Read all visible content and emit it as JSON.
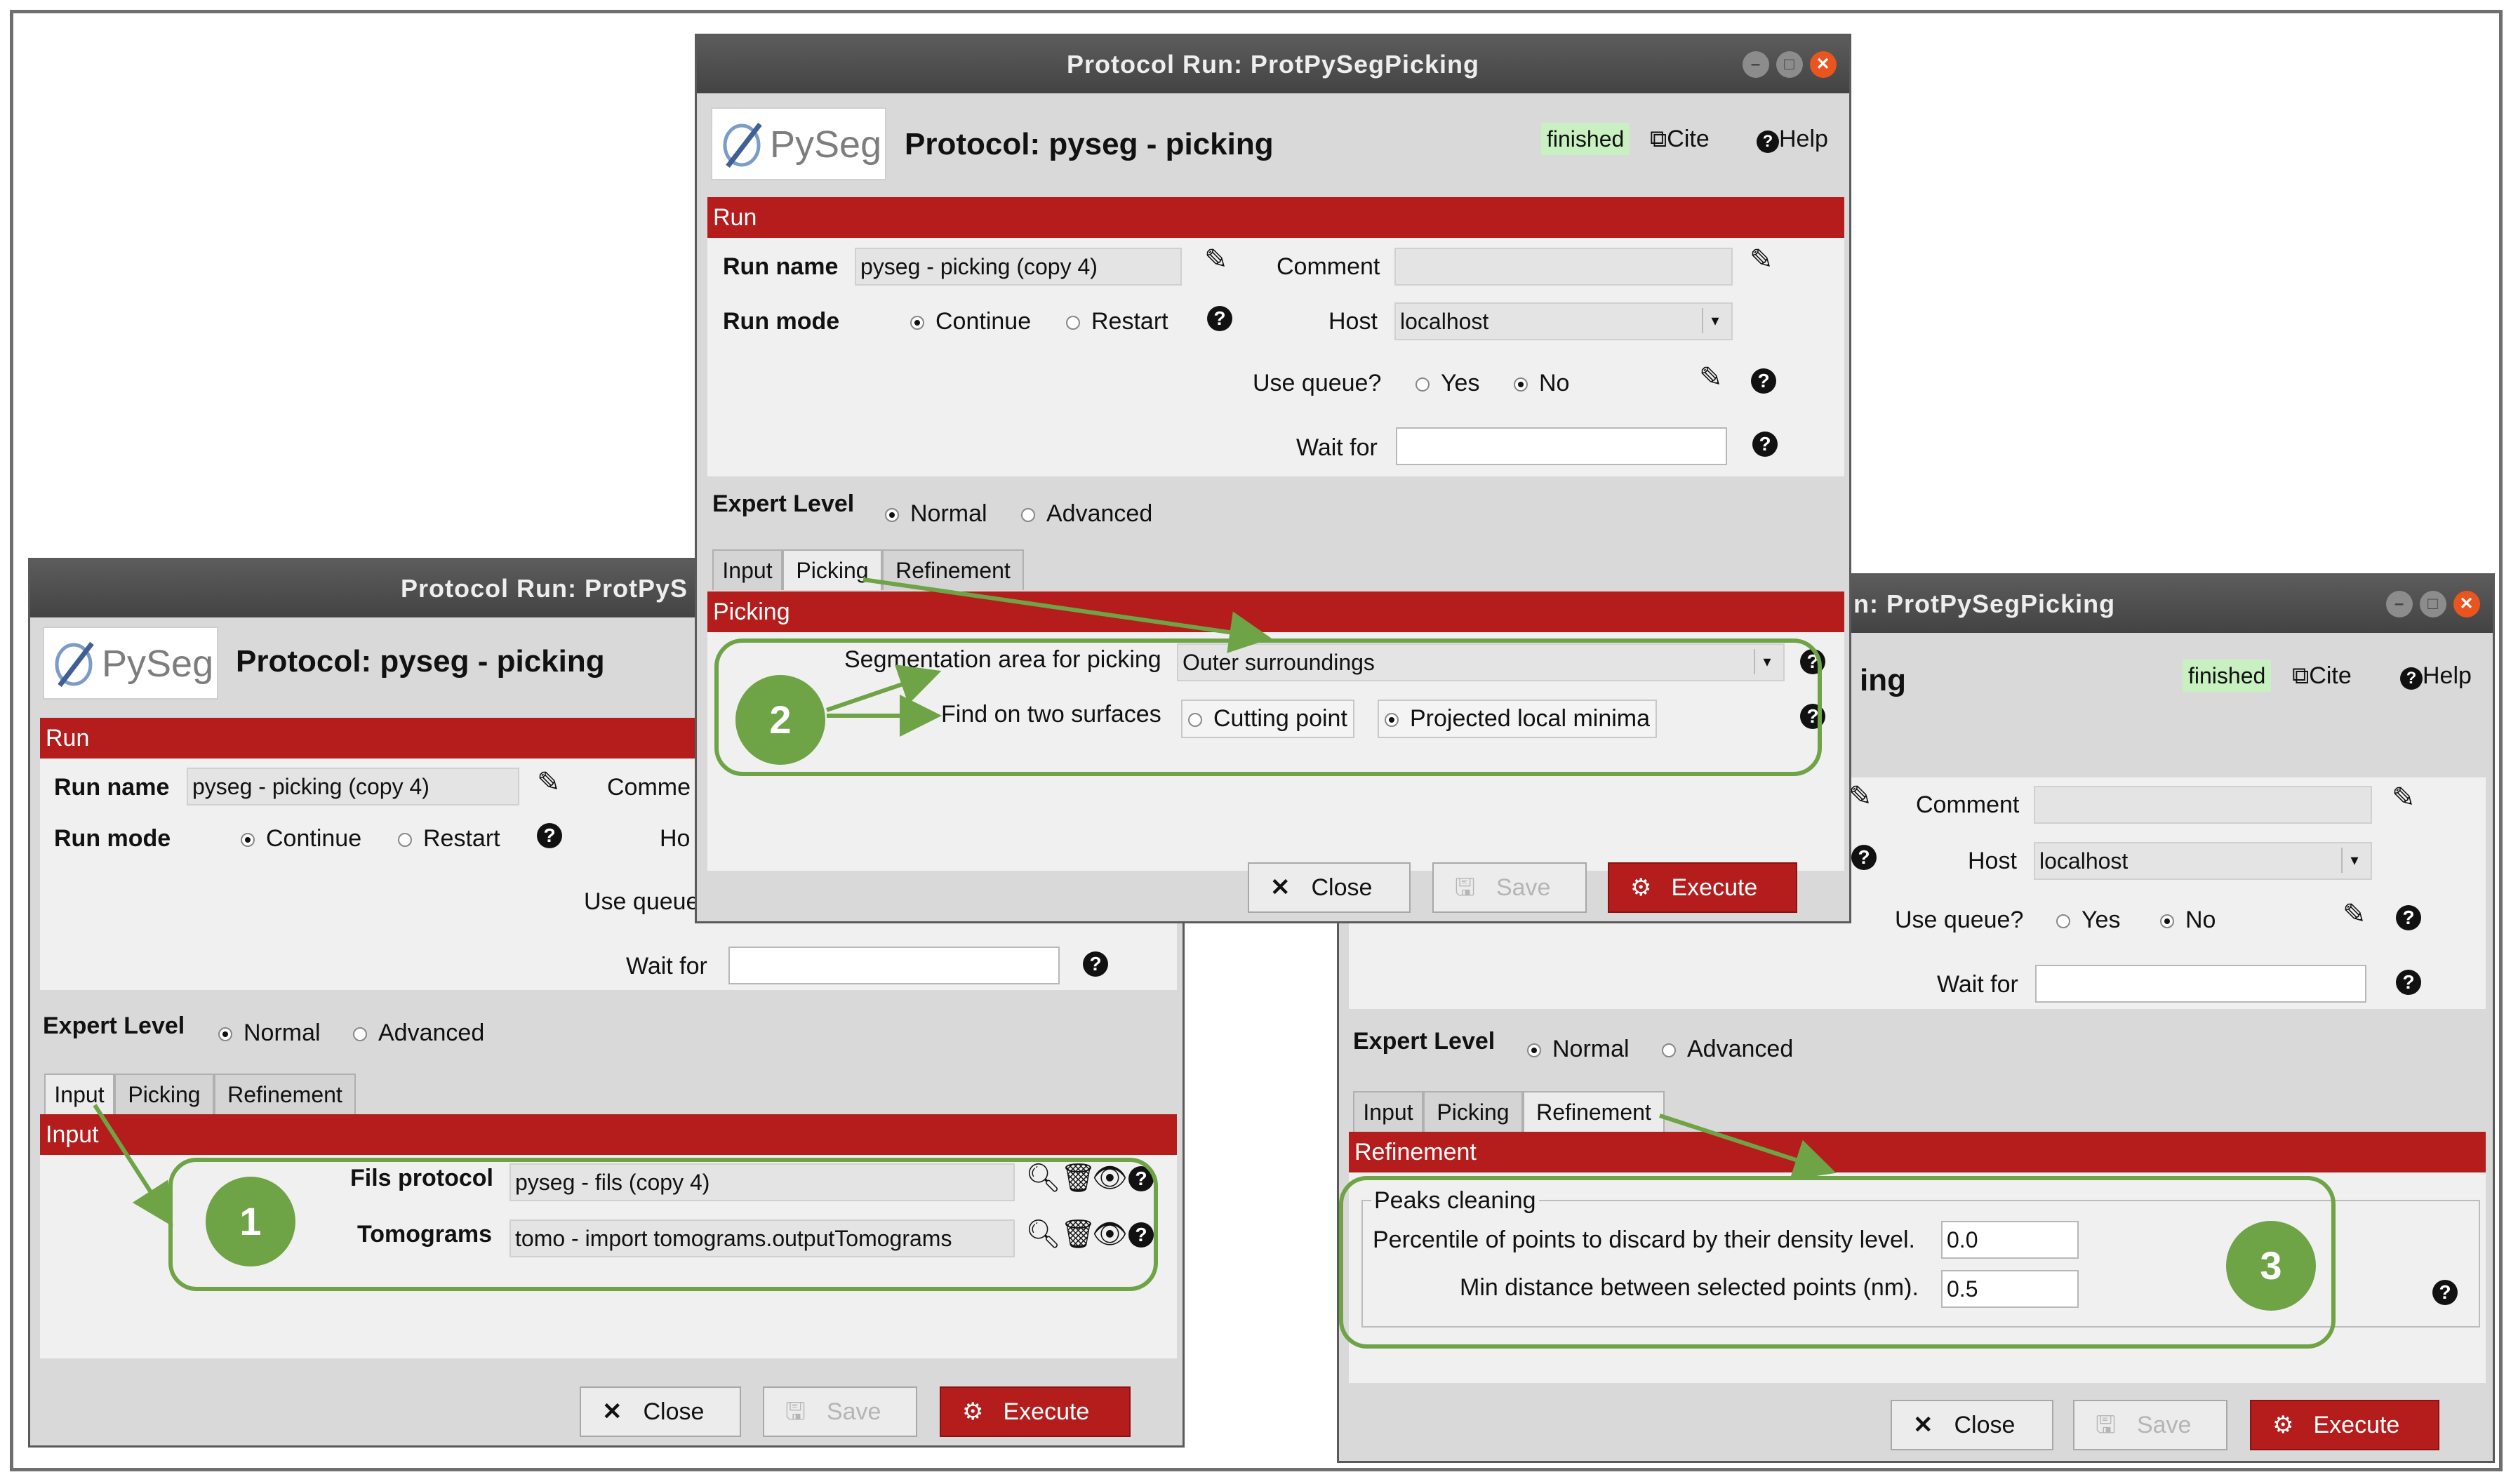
{
  "windows": {
    "main": {
      "title": "Protocol Run: ProtPySegPicking",
      "logo_text": "PySeg",
      "protocol_title": "Protocol: pyseg - picking",
      "status": "finished",
      "cite": "Cite",
      "help": "Help",
      "run_section": "Run",
      "run_name_label": "Run name",
      "run_name_value": "pyseg - picking (copy 4)",
      "comment_label": "Comment",
      "run_mode_label": "Run mode",
      "continue_label": "Continue",
      "restart_label": "Restart",
      "host_label": "Host",
      "host_value": "localhost",
      "use_queue_label": "Use queue?",
      "yes_label": "Yes",
      "no_label": "No",
      "wait_for_label": "Wait for",
      "expert_level_label": "Expert Level",
      "normal_label": "Normal",
      "advanced_label": "Advanced",
      "tabs": [
        "Input",
        "Picking",
        "Refinement"
      ],
      "section_title": "Picking",
      "seg_area_label": "Segmentation area for picking",
      "seg_area_value": "Outer surroundings",
      "find_surfaces_label": "Find on two surfaces",
      "cutting_point_label": "Cutting point",
      "projected_minima_label": "Projected local minima",
      "close_label": "Close",
      "save_label": "Save",
      "execute_label": "Execute"
    },
    "left": {
      "title": "Protocol Run: ProtPyS",
      "logo_text": "PySeg",
      "protocol_title": "Protocol: pyseg - picking",
      "run_section": "Run",
      "run_name_label": "Run name",
      "run_name_value": "pyseg - picking (copy 4)",
      "comment_label": "Comme",
      "run_mode_label": "Run mode",
      "continue_label": "Continue",
      "restart_label": "Restart",
      "host_label": "Ho",
      "use_queue_label": "Use queue",
      "wait_for_label": "Wait for",
      "expert_level_label": "Expert Level",
      "normal_label": "Normal",
      "advanced_label": "Advanced",
      "tabs": [
        "Input",
        "Picking",
        "Refinement"
      ],
      "section_title": "Input",
      "fils_label": "Fils protocol",
      "fils_value": "pyseg - fils (copy 4)",
      "tomograms_label": "Tomograms",
      "tomograms_value": "tomo - import tomograms.outputTomograms",
      "close_label": "Close",
      "save_label": "Save",
      "execute_label": "Execute"
    },
    "right": {
      "title": "un: ProtPySegPicking",
      "protocol_title_partial": "ing",
      "status": "finished",
      "cite": "Cite",
      "help": "Help",
      "comment_label": "Comment",
      "host_label": "Host",
      "host_value": "localhost",
      "use_queue_label": "Use queue?",
      "yes_label": "Yes",
      "no_label": "No",
      "wait_for_label": "Wait for",
      "expert_level_label": "Expert Level",
      "normal_label": "Normal",
      "advanced_label": "Advanced",
      "tabs": [
        "Input",
        "Picking",
        "Refinement"
      ],
      "section_title": "Refinement",
      "group_title": "Peaks cleaning",
      "percentile_label": "Percentile of points to discard by their density level.",
      "percentile_value": "0.0",
      "min_distance_label": "Min distance between selected points (nm).",
      "min_distance_value": "0.5",
      "close_label": "Close",
      "save_label": "Save",
      "execute_label": "Execute"
    }
  },
  "callouts": [
    "1",
    "2",
    "3"
  ],
  "colors": {
    "accent_red": "#b51c1c",
    "callout_green": "#6ea346",
    "status_green": "#c8f0c0"
  },
  "icons": [
    "pencil-icon",
    "help-icon",
    "search-icon",
    "trash-icon",
    "eye-icon",
    "close-x-icon",
    "save-icon",
    "gears-icon",
    "external-link-icon"
  ]
}
